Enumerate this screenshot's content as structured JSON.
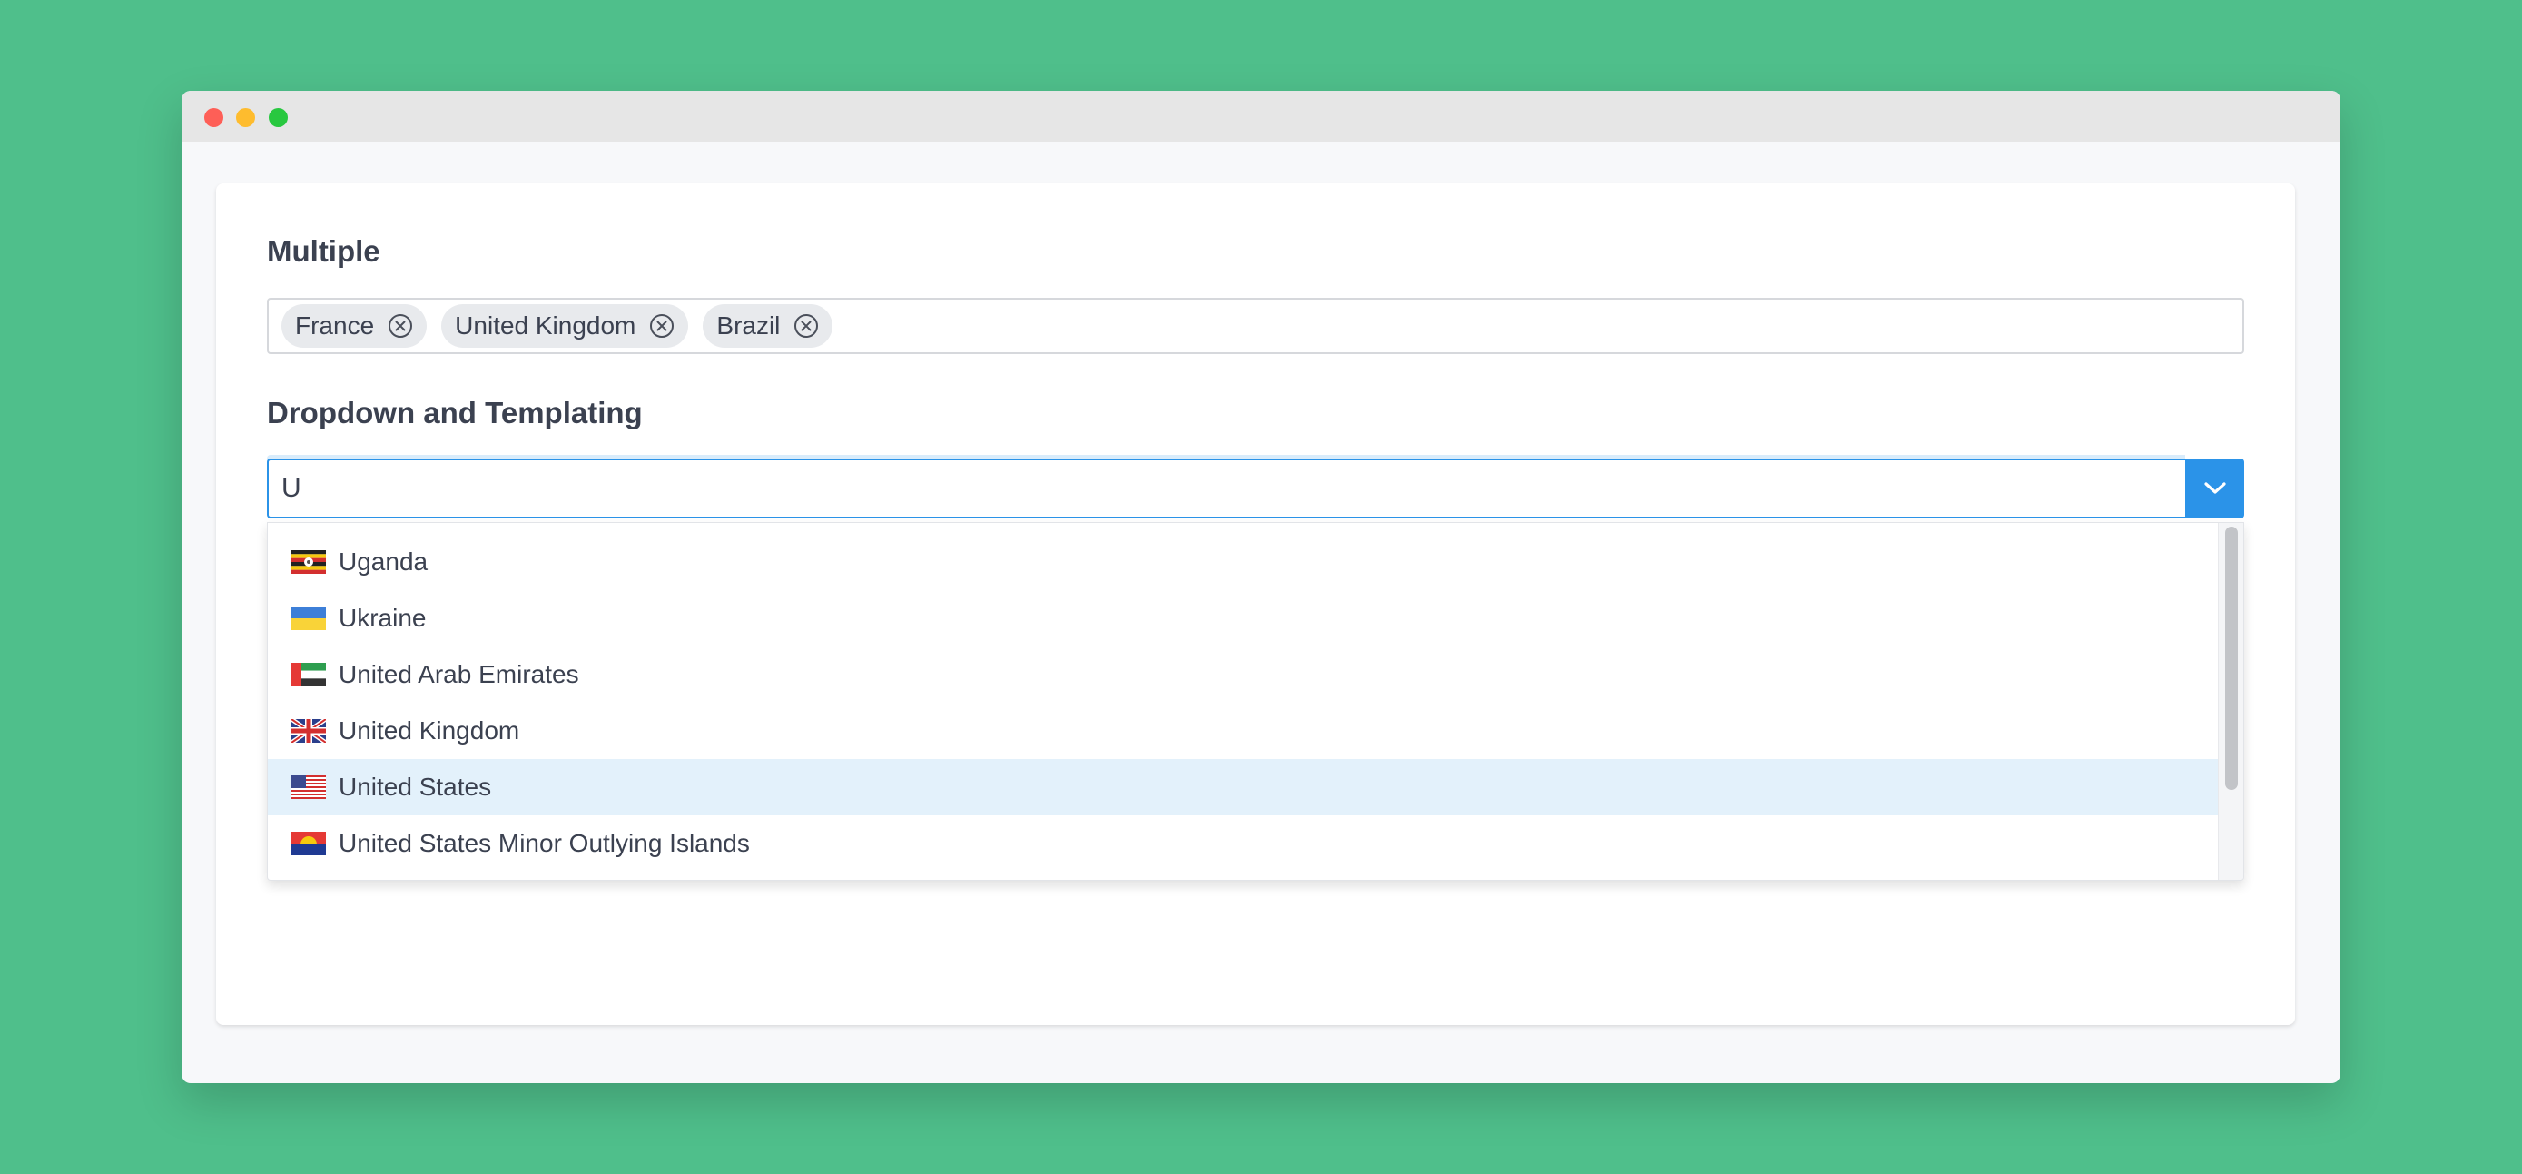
{
  "window": {
    "controls": [
      "close",
      "minimize",
      "maximize"
    ]
  },
  "multiple": {
    "label": "Multiple",
    "tags": [
      {
        "label": "France"
      },
      {
        "label": "United Kingdom"
      },
      {
        "label": "Brazil"
      }
    ]
  },
  "dropdown": {
    "label": "Dropdown and Templating",
    "input_value": "U",
    "options": [
      {
        "label": "Uganda",
        "flag": "uganda-flag-icon"
      },
      {
        "label": "Ukraine",
        "flag": "ukraine-flag-icon"
      },
      {
        "label": "United Arab Emirates",
        "flag": "uae-flag-icon"
      },
      {
        "label": "United Kingdom",
        "flag": "uk-flag-icon"
      },
      {
        "label": "United States",
        "flag": "us-flag-icon",
        "highlighted": true
      },
      {
        "label": "United States Minor Outlying Islands",
        "flag": "us-minor-outlying-islands-flag-icon"
      }
    ]
  },
  "colors": {
    "background": "#4fbf8b",
    "accent": "#2b93e8",
    "highlight": "#e3f1fb",
    "text": "#3b4150"
  }
}
